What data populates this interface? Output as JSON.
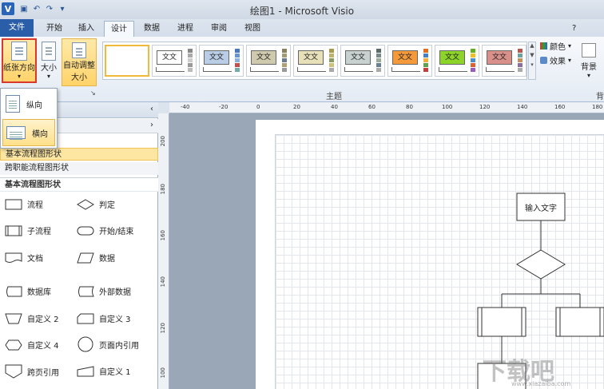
{
  "app": {
    "title": "绘图1 - Microsoft Visio",
    "logo": "V"
  },
  "tabs": [
    {
      "label": "文件"
    },
    {
      "label": "开始"
    },
    {
      "label": "插入"
    },
    {
      "label": "设计"
    },
    {
      "label": "数据"
    },
    {
      "label": "进程"
    },
    {
      "label": "审阅"
    },
    {
      "label": "视图"
    }
  ],
  "ribbon": {
    "orientation_label": "纸张方向",
    "size_label": "大小",
    "autosize_label_1": "自动调整",
    "autosize_label_2": "大小",
    "theme_text": "文文",
    "colors_label": "颜色",
    "effects_label": "效果",
    "background_label": "背景",
    "themes_group_label": "主题",
    "background_group_label": "背"
  },
  "orientation_menu": {
    "portrait": "纵向",
    "landscape": "横向"
  },
  "left_panel": {
    "stencils": [
      "基本流程图形状",
      "跨职能流程图形状"
    ],
    "shapes_title": "基本流程图形状",
    "shapes": [
      "流程",
      "判定",
      "子流程",
      "开始/结束",
      "文档",
      "数据",
      "数据库",
      "外部数据",
      "自定义 2",
      "自定义 3",
      "自定义 4",
      "页面内引用",
      "跨页引用",
      "自定义 1"
    ]
  },
  "rulers": {
    "top": [
      "-40",
      "-20",
      "0",
      "20",
      "40",
      "60",
      "80",
      "100",
      "120",
      "140",
      "160",
      "180"
    ],
    "left": [
      "200",
      "180",
      "160",
      "140",
      "120",
      "100"
    ]
  },
  "diagram": {
    "input_text": "输入文字"
  },
  "watermark": {
    "text": "下载吧",
    "url": "www.xiazaiba.com"
  },
  "colors": {
    "file_tab": "#2b5ea9",
    "highlight": "#ffd36a",
    "selection_border": "#d9382c"
  }
}
